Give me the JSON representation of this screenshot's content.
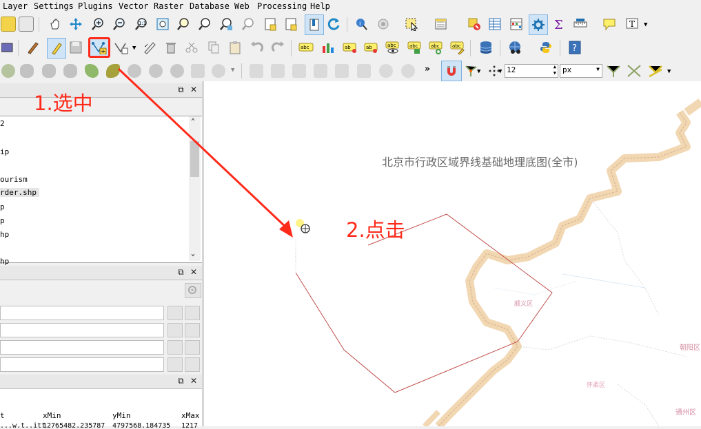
{
  "menubar": {
    "items": [
      "Layer",
      "Settings",
      "Plugins",
      "Vector",
      "Raster",
      "Database",
      "Web",
      "Processing",
      "Help"
    ]
  },
  "toolbar3": {
    "snap_tolerance_value": "12",
    "snap_unit": "px",
    "overflow_chevron": "»"
  },
  "layers_panel": {
    "items": [
      "2",
      "ip",
      "ourism",
      "rder.shp",
      "p",
      "p",
      "hp",
      "hp"
    ]
  },
  "attr_panel": {
    "columns": [
      "t",
      "xMin",
      "yMin",
      "xMax"
    ],
    "row": [
      "...w.t..itt",
      "12765482.235787",
      "4797568.184735",
      "1217"
    ]
  },
  "map": {
    "title": "北京市行政区域界线基础地理底图(全市)",
    "district_label_1": "顺义区",
    "district_label_2": "朝阳区",
    "district_label_3": "怀柔区",
    "district_label_4": "通州区"
  },
  "annotations": {
    "step1": "1.选中",
    "step2": "2.点击",
    "color": "#ff2a1a"
  }
}
